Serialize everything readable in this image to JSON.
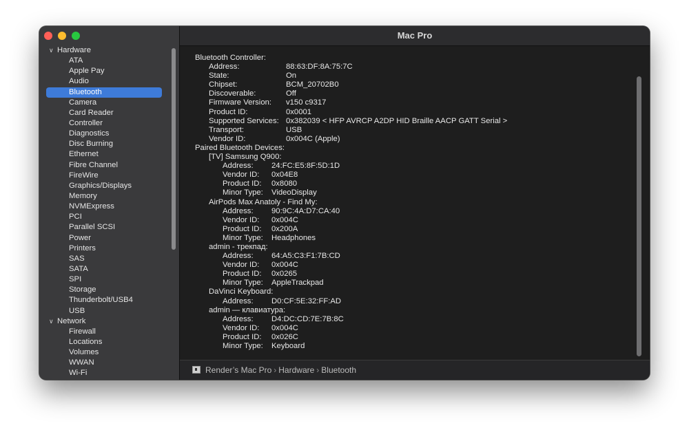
{
  "window": {
    "title": "Mac Pro"
  },
  "sidebar": {
    "groups": [
      {
        "label": "Hardware",
        "items": [
          "ATA",
          "Apple Pay",
          "Audio",
          "Bluetooth",
          "Camera",
          "Card Reader",
          "Controller",
          "Diagnostics",
          "Disc Burning",
          "Ethernet",
          "Fibre Channel",
          "FireWire",
          "Graphics/Displays",
          "Memory",
          "NVMExpress",
          "PCI",
          "Parallel SCSI",
          "Power",
          "Printers",
          "SAS",
          "SATA",
          "SPI",
          "Storage",
          "Thunderbolt/USB4",
          "USB"
        ]
      },
      {
        "label": "Network",
        "items": [
          "Firewall",
          "Locations",
          "Volumes",
          "WWAN",
          "Wi-Fi"
        ]
      }
    ],
    "selected": "Bluetooth"
  },
  "content": {
    "lines": [
      {
        "level": 0,
        "k": "Bluetooth Controller:",
        "v": ""
      },
      {
        "level": 1,
        "k": "Address:",
        "v": "88:63:DF:8A:75:7C"
      },
      {
        "level": 1,
        "k": "State:",
        "v": "On"
      },
      {
        "level": 1,
        "k": "Chipset:",
        "v": "BCM_20702B0"
      },
      {
        "level": 1,
        "k": "Discoverable:",
        "v": "Off"
      },
      {
        "level": 1,
        "k": "Firmware Version:",
        "v": "v150 c9317"
      },
      {
        "level": 1,
        "k": "Product ID:",
        "v": "0x0001"
      },
      {
        "level": 1,
        "k": "Supported Services:",
        "v": "0x382039 < HFP AVRCP A2DP HID Braille AACP GATT Serial >"
      },
      {
        "level": 1,
        "k": "Transport:",
        "v": "USB"
      },
      {
        "level": 1,
        "k": "Vendor ID:",
        "v": "0x004C (Apple)"
      },
      {
        "level": 0,
        "k": "Paired Bluetooth Devices:",
        "v": ""
      },
      {
        "level": 1,
        "k": "[TV] Samsung Q900:",
        "v": "",
        "hdr": true
      },
      {
        "level": 2,
        "k": "Address:",
        "v": "24:FC:E5:8F:5D:1D"
      },
      {
        "level": 2,
        "k": "Vendor ID:",
        "v": "0x04E8"
      },
      {
        "level": 2,
        "k": "Product ID:",
        "v": "0x8080"
      },
      {
        "level": 2,
        "k": "Minor Type:",
        "v": "VideoDisplay"
      },
      {
        "level": 1,
        "k": "AirPods Max Anatoly - Find My:",
        "v": "",
        "hdr": true
      },
      {
        "level": 2,
        "k": "Address:",
        "v": "90:9C:4A:D7:CA:40"
      },
      {
        "level": 2,
        "k": "Vendor ID:",
        "v": "0x004C"
      },
      {
        "level": 2,
        "k": "Product ID:",
        "v": "0x200A"
      },
      {
        "level": 2,
        "k": "Minor Type:",
        "v": "Headphones"
      },
      {
        "level": 1,
        "k": "admin - трекпад:",
        "v": "",
        "hdr": true
      },
      {
        "level": 2,
        "k": "Address:",
        "v": "64:A5:C3:F1:7B:CD"
      },
      {
        "level": 2,
        "k": "Vendor ID:",
        "v": "0x004C"
      },
      {
        "level": 2,
        "k": "Product ID:",
        "v": "0x0265"
      },
      {
        "level": 2,
        "k": "Minor Type:",
        "v": "AppleTrackpad"
      },
      {
        "level": 1,
        "k": "DaVinci Keyboard:",
        "v": "",
        "hdr": true
      },
      {
        "level": 2,
        "k": "Address:",
        "v": "D0:CF:5E:32:FF:AD"
      },
      {
        "level": 1,
        "k": "admin — клавиатура:",
        "v": "",
        "hdr": true
      },
      {
        "level": 2,
        "k": "Address:",
        "v": "D4:DC:CD:7E:7B:8C"
      },
      {
        "level": 2,
        "k": "Vendor ID:",
        "v": "0x004C"
      },
      {
        "level": 2,
        "k": "Product ID:",
        "v": "0x026C"
      },
      {
        "level": 2,
        "k": "Minor Type:",
        "v": "Keyboard"
      }
    ]
  },
  "statusbar": {
    "path": [
      "Render’s Mac Pro",
      "Hardware",
      "Bluetooth"
    ],
    "separator": "›"
  },
  "colors": {
    "selection": "#3e7bd9",
    "close": "#ff5f57",
    "minimize": "#febc2e",
    "maximize": "#28c840"
  },
  "icons": {
    "group_toggle": "chevron-down-icon",
    "status": "computer-icon"
  }
}
